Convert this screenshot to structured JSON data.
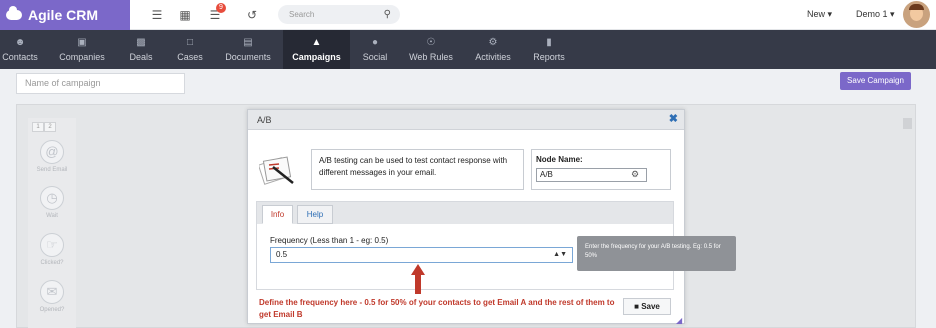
{
  "app": {
    "brand": "Agile CRM"
  },
  "topbar": {
    "notification_count": "9",
    "search_placeholder": "Search",
    "new_menu": "New",
    "user_menu": "Demo 1"
  },
  "nav": {
    "items": [
      {
        "label": "Contacts",
        "icon": "person-icon"
      },
      {
        "label": "Companies",
        "icon": "building-icon"
      },
      {
        "label": "Deals",
        "icon": "money-icon"
      },
      {
        "label": "Cases",
        "icon": "folder-icon"
      },
      {
        "label": "Documents",
        "icon": "document-icon"
      },
      {
        "label": "Campaigns",
        "icon": "sitemap-icon",
        "active": true
      },
      {
        "label": "Social",
        "icon": "chat-icon"
      },
      {
        "label": "Web Rules",
        "icon": "globe-icon"
      },
      {
        "label": "Activities",
        "icon": "cogs-icon"
      },
      {
        "label": "Reports",
        "icon": "bar-chart-icon"
      }
    ]
  },
  "campaign": {
    "name_placeholder": "Name of campaign",
    "save_label": "Save Campaign"
  },
  "palette": {
    "tabs": [
      "1",
      "2"
    ],
    "items": [
      {
        "label": "Send Email"
      },
      {
        "label": "Wait"
      },
      {
        "label": "Clicked?"
      },
      {
        "label": "Opened?"
      }
    ]
  },
  "modal": {
    "title": "A/B",
    "description": "A/B testing can be used to test contact response with different messages in your email.",
    "node_name_label": "Node Name:",
    "node_name_value": "A/B",
    "tabs": [
      "Info",
      "Help"
    ],
    "frequency_label": "Frequency (Less than 1 - eg: 0.5)",
    "frequency_value": "0.5",
    "tooltip": "Enter the frequency for your A/B testing. Eg: 0.5 for 50%",
    "annotation": "Define the frequency here - 0.5 for 50% of your contacts to get Email A and the rest of them to get Email B",
    "save_label": "Save"
  },
  "colors": {
    "brand": "#7b68c9",
    "nav_bg": "#363a48",
    "annotation_red": "#c0392b"
  }
}
